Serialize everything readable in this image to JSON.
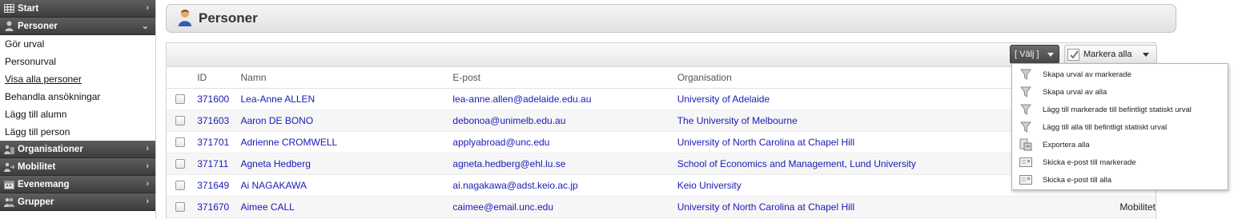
{
  "sidebar": {
    "sections": [
      {
        "label": "Start",
        "icon": "grid-icon",
        "expanded": false
      },
      {
        "label": "Personer",
        "icon": "person-icon",
        "expanded": true
      },
      {
        "label": "Organisationer",
        "icon": "organization-icon",
        "expanded": false
      },
      {
        "label": "Mobilitet",
        "icon": "mobility-icon",
        "expanded": false
      },
      {
        "label": "Evenemang",
        "icon": "event-icon",
        "expanded": false
      },
      {
        "label": "Grupper",
        "icon": "group-icon",
        "expanded": false
      }
    ],
    "personer_items": [
      "Gör urval",
      "Personurval",
      "Visa alla personer",
      "Behandla ansökningar",
      "Lägg till alumn",
      "Lägg till person"
    ]
  },
  "header": {
    "title": "Personer",
    "icon": "person-icon"
  },
  "toolbar": {
    "valj_label": "[ Välj ]",
    "markera_label": "Markera alla"
  },
  "table": {
    "columns": [
      "ID",
      "Namn",
      "E-post",
      "Organisation"
    ],
    "rows": [
      {
        "id": "371600",
        "name": "Lea-Anne ALLEN",
        "email": "lea-anne.allen@adelaide.edu.au",
        "org": "University of Adelaide",
        "extra": ""
      },
      {
        "id": "371603",
        "name": "Aaron DE BONO",
        "email": "debonoa@unimelb.edu.au",
        "org": "The University of Melbourne",
        "extra": ""
      },
      {
        "id": "371701",
        "name": "Adrienne CROMWELL",
        "email": "applyabroad@unc.edu",
        "org": "University of North Carolina at Chapel Hill",
        "extra": ""
      },
      {
        "id": "371711",
        "name": "Agneta Hedberg",
        "email": "agneta.hedberg@ehl.lu.se",
        "org": "School of Economics and Management, Lund University",
        "extra": ""
      },
      {
        "id": "371649",
        "name": "Ai NAGAKAWA",
        "email": "ai.nagakawa@adst.keio.ac.jp",
        "org": "Keio University",
        "extra": ""
      },
      {
        "id": "371670",
        "name": "Aimee CALL",
        "email": "caimee@email.unc.edu",
        "org": "University of North Carolina at Chapel Hill",
        "extra": "Mobilitet"
      }
    ]
  },
  "menu": {
    "items": [
      {
        "label": "Skapa urval av markerade",
        "icon": "filter-icon"
      },
      {
        "label": "Skapa urval av alla",
        "icon": "filter-icon"
      },
      {
        "label": "Lägg till markerade till befintligt statiskt urval",
        "icon": "filter-icon"
      },
      {
        "label": "Lägg till alla till befintligt statiskt urval",
        "icon": "filter-icon"
      },
      {
        "label": "Exportera alla",
        "icon": "export-icon"
      },
      {
        "label": "Skicka e-post till markerade",
        "icon": "envelope-icon"
      },
      {
        "label": "Skicka e-post till alla",
        "icon": "envelope-icon"
      }
    ]
  },
  "colors": {
    "link": "#1a1ab8",
    "sidebar_header": "#4a4a4a"
  }
}
